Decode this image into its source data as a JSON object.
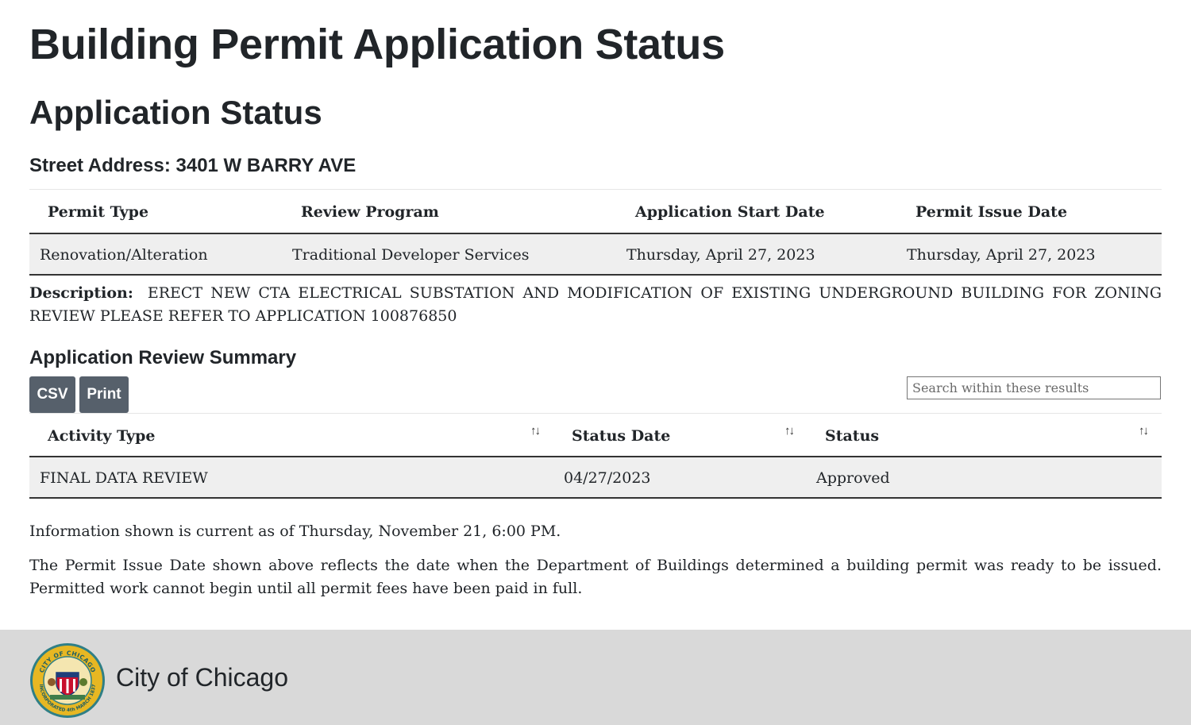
{
  "page": {
    "title": "Building Permit Application Status",
    "subtitle": "Application Status",
    "street_address": "Street Address: 3401 W BARRY AVE"
  },
  "permit_table": {
    "headers": [
      "Permit Type",
      "Review Program",
      "Application Start Date",
      "Permit Issue Date"
    ],
    "rows": [
      [
        "Renovation/Alteration",
        "Traditional Developer Services",
        "Thursday, April 27, 2023",
        "Thursday, April 27, 2023"
      ]
    ]
  },
  "description": {
    "label": "Description:",
    "text": "ERECT NEW CTA ELECTRICAL SUBSTATION AND MODIFICATION OF EXISTING UNDERGROUND BUILDING FOR ZONING REVIEW PLEASE REFER TO APPLICATION 100876850"
  },
  "summary": {
    "title": "Application Review Summary",
    "csv_label": "CSV",
    "print_label": "Print",
    "search_placeholder": "Search within these results",
    "search_value": "",
    "sort_icon": "sort-arrows-icon",
    "headers": [
      "Activity Type",
      "Status Date",
      "Status"
    ],
    "rows": [
      [
        "FINAL DATA REVIEW",
        "04/27/2023",
        "Approved"
      ]
    ]
  },
  "notes": {
    "current_as_of": "Information shown is current as of Thursday, November 21, 6:00 PM.",
    "issue_date_note": "The Permit Issue Date shown above reflects the date when the Department of Buildings determined a building permit was ready to be issued. Permitted work cannot begin until all permit fees have been paid in full."
  },
  "footer": {
    "name": "City of Chicago",
    "seal_text_top": "CITY OF CHICAGO",
    "seal_text_bottom": "INCORPORATED 4th MARCH 1837",
    "seal_icon": "city-seal-icon"
  },
  "colors": {
    "button_bg": "#56606b",
    "row_bg": "#efefef",
    "footer_bg": "#d9d9d9",
    "seal_ring": "#2f7f86",
    "seal_band": "#e7b723"
  }
}
